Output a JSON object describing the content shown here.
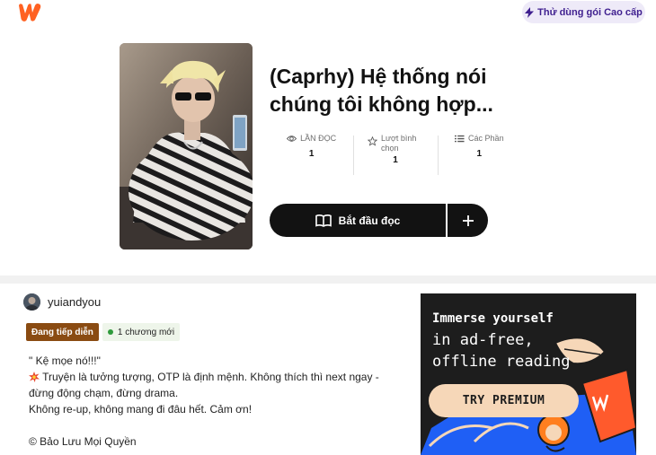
{
  "header": {
    "logo_icon": "wattpad-logo-icon",
    "premium_label": "Thử dùng gói Cao cấp",
    "premium_icon": "lightning-icon"
  },
  "story": {
    "title_line1": "(Caprhy) Hệ thống nói",
    "title_line2": "chúng tôi không hợp...",
    "stats": {
      "reads_label": "LẦN ĐỌC",
      "reads_value": "1",
      "votes_label": "Lượt bình chọn",
      "votes_value": "1",
      "parts_label": "Các Phần",
      "parts_value": "1"
    },
    "read_button": "Bắt đầu đọc"
  },
  "details": {
    "author": "yuiandyou",
    "status_badge": "Đang tiếp diễn",
    "new_chapters": "1 chương mới",
    "description": [
      "\" Kệ mọe nó!!!\"",
      "Truyện là tưởng tượng, OTP là định mệnh. Không thích thì next ngay -",
      "đừng động chạm, đừng drama.",
      "Không re-up, không mang đi đâu hết. Cảm ơn!",
      "© Bảo Lưu Mọi Quyền"
    ]
  },
  "ad": {
    "line1": "Immerse yourself",
    "line2": "in ad-free,",
    "line3": "offline reading",
    "cta": "TRY PREMIUM"
  },
  "colors": {
    "brand": "#ff6122",
    "dark": "#121212",
    "status": "#8a4b12",
    "ad_blue": "#1f5ff5",
    "ad_peach": "#f6d7b8"
  }
}
